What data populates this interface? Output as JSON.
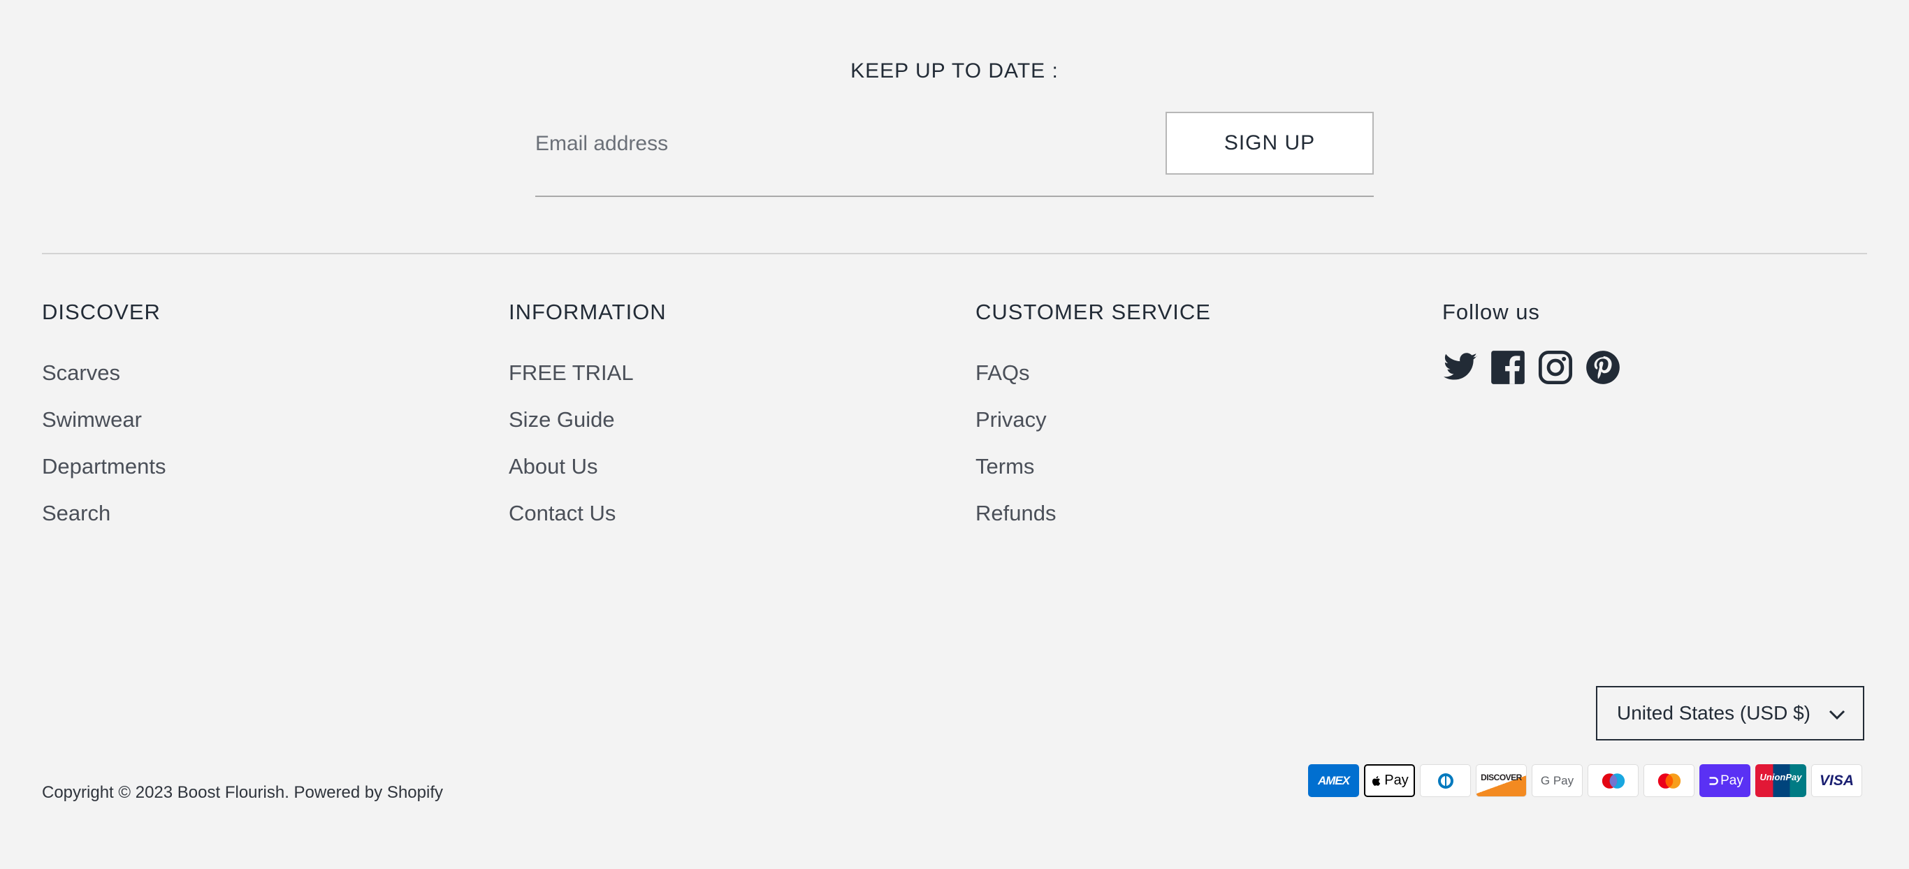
{
  "newsletter": {
    "title": "KEEP UP TO DATE :",
    "email_placeholder": "Email address",
    "signup_label": "SIGN UP"
  },
  "columns": {
    "discover": {
      "heading": "DISCOVER",
      "links": [
        "Scarves",
        "Swimwear",
        "Departments",
        "Search"
      ]
    },
    "information": {
      "heading": "INFORMATION",
      "links": [
        "FREE TRIAL",
        "Size Guide",
        "About Us",
        "Contact Us"
      ]
    },
    "customer_service": {
      "heading": "CUSTOMER SERVICE",
      "links": [
        "FAQs",
        "Privacy",
        "Terms",
        "Refunds"
      ]
    },
    "follow": {
      "heading": "Follow us",
      "icons": [
        "twitter-icon",
        "facebook-icon",
        "instagram-icon",
        "pinterest-icon"
      ]
    }
  },
  "currency": {
    "selected": "United States (USD $)"
  },
  "copyright": "Copyright © 2023 Boost Flourish. Powered by Shopify",
  "payments": [
    {
      "name": "amex-icon",
      "label": "AMEX",
      "bg": "#016fd0",
      "fg": "#ffffff"
    },
    {
      "name": "apple-pay-icon",
      "label": "Pay",
      "bg": "#ffffff",
      "fg": "#000000"
    },
    {
      "name": "diners-club-icon",
      "label": "D",
      "bg": "#ffffff",
      "fg": "#0079be"
    },
    {
      "name": "discover-icon",
      "label": "DISCOVER",
      "bg": "#ffffff",
      "fg": "#231f20"
    },
    {
      "name": "google-pay-icon",
      "label": "G Pay",
      "bg": "#ffffff",
      "fg": "#5f6368"
    },
    {
      "name": "maestro-icon",
      "label": "",
      "bg": "#ffffff",
      "fg": "#000000"
    },
    {
      "name": "mastercard-icon",
      "label": "",
      "bg": "#ffffff",
      "fg": "#000000"
    },
    {
      "name": "shop-pay-icon",
      "label": "Pay",
      "bg": "#5a31f4",
      "fg": "#ffffff"
    },
    {
      "name": "unionpay-icon",
      "label": "UnionPay",
      "bg": "#e21836",
      "fg": "#ffffff"
    },
    {
      "name": "visa-icon",
      "label": "VISA",
      "bg": "#ffffff",
      "fg": "#1a1f71"
    }
  ]
}
